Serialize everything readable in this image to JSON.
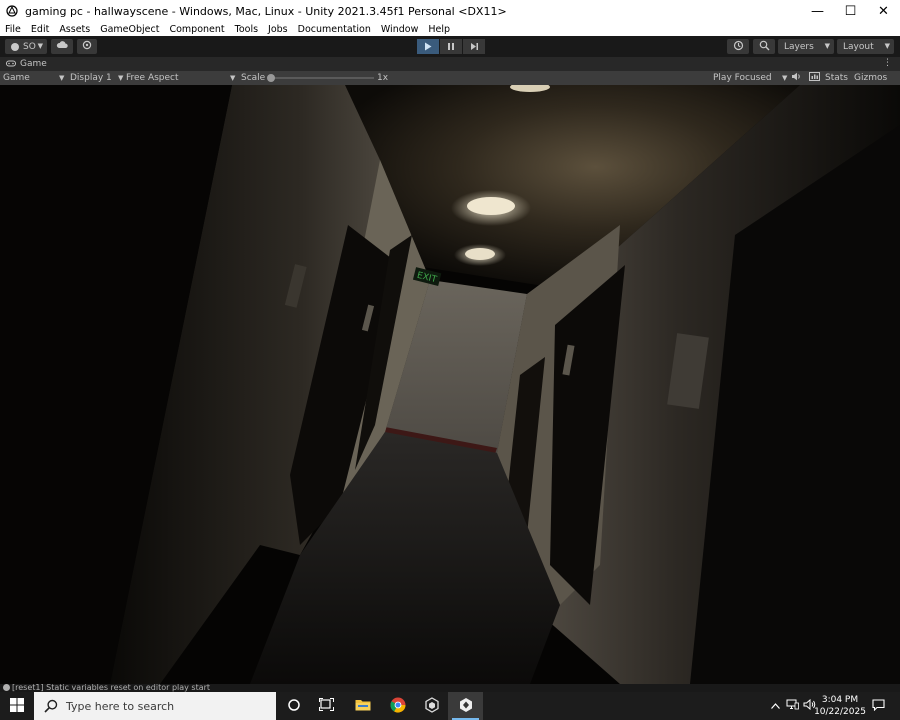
{
  "window": {
    "title": "gaming pc - hallwayscene - Windows, Mac, Linux - Unity 2021.3.45f1 Personal <DX11>",
    "minimize_glyph": "—",
    "maximize_glyph": "☐",
    "close_glyph": "✕"
  },
  "menu": {
    "items": [
      "File",
      "Edit",
      "Assets",
      "GameObject",
      "Component",
      "Tools",
      "Jobs",
      "Documentation",
      "Window",
      "Help"
    ]
  },
  "toolbar": {
    "account_label": "SO",
    "layers_label": "Layers",
    "layout_label": "Layout",
    "play_active": true
  },
  "game_tab": {
    "label": "Game",
    "kebab": "⋮"
  },
  "game_bar": {
    "view_label": "Game",
    "display_label": "Display 1",
    "aspect_label": "Free Aspect",
    "scale_label": "Scale",
    "scale_value": "1x",
    "play_focused_label": "Play Focused",
    "stats_label": "Stats",
    "gizmos_label": "Gizmos"
  },
  "viewport": {
    "exit_sign_text": "EXIT"
  },
  "console": {
    "message": "[reset1] Static variables reset on editor play start"
  },
  "taskbar": {
    "search_placeholder": "Type here to search",
    "clock_time": "3:04 PM",
    "clock_date": "10/22/2025",
    "apps": [
      "task-view",
      "file-explorer",
      "chrome",
      "unity-hub",
      "unity-editor"
    ],
    "active_app": "unity-editor"
  },
  "colors": {
    "unity_dark": "#191919",
    "unity_panel": "#3c3c3c",
    "play_active": "#3a5b7c",
    "taskbar": "#1c1c1c",
    "exit_sign": "#3fa64a"
  }
}
